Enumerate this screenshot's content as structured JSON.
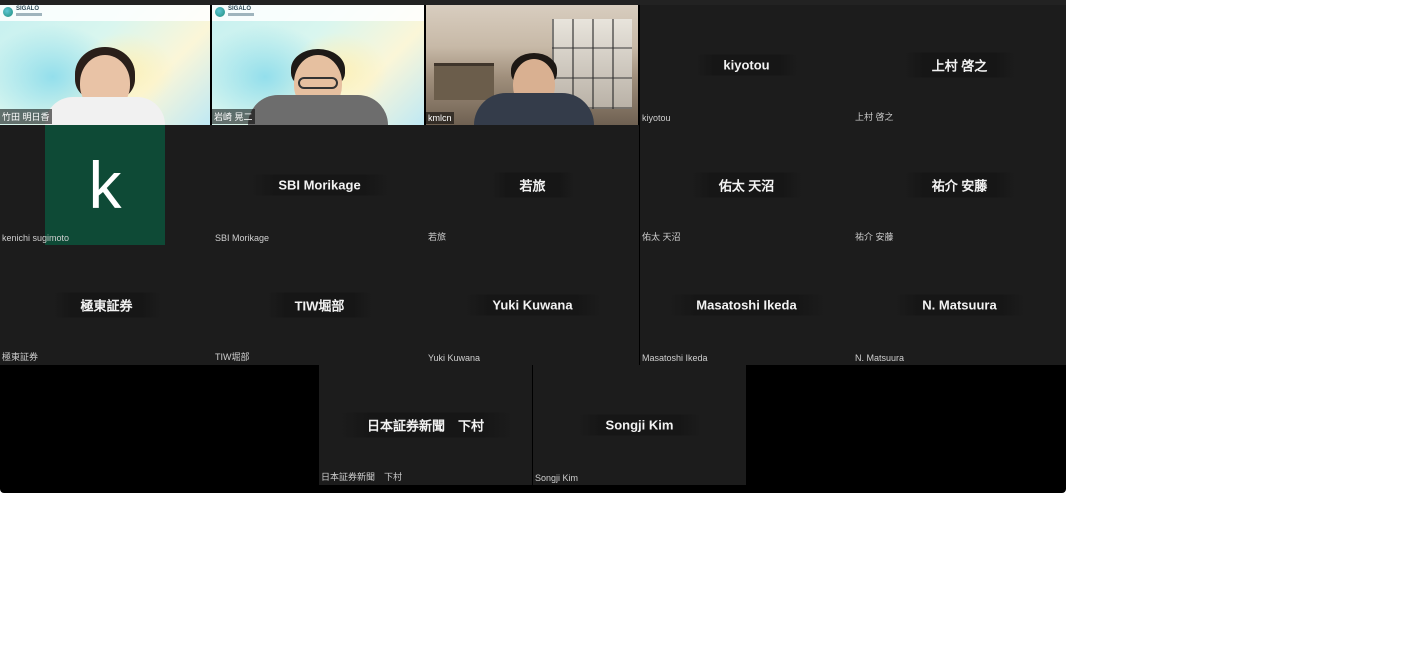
{
  "participants": [
    {
      "id": "p1",
      "corner_name": "竹田 明日香",
      "type": "video",
      "logo": "SIGALO"
    },
    {
      "id": "p2",
      "corner_name": "岩崎 晃二",
      "type": "video",
      "logo": "SIGALO"
    },
    {
      "id": "p3",
      "corner_name": "kmlcn",
      "type": "video"
    },
    {
      "id": "p4",
      "center_name": "kiyotou",
      "corner_name": "kiyotou",
      "type": "name"
    },
    {
      "id": "p5",
      "center_name": "上村 啓之",
      "corner_name": "上村 啓之",
      "type": "name"
    },
    {
      "id": "p6",
      "avatar_letter": "k",
      "corner_name": "kenichi sugimoto",
      "type": "avatar",
      "avatar_color": "#0e4a36"
    },
    {
      "id": "p7",
      "center_name": "SBI Morikage",
      "corner_name": "SBI Morikage",
      "type": "name"
    },
    {
      "id": "p8",
      "center_name": "若旅",
      "corner_name": "若旅",
      "type": "name"
    },
    {
      "id": "p9",
      "center_name": "佑太 天沼",
      "corner_name": "佑太 天沼",
      "type": "name"
    },
    {
      "id": "p10",
      "center_name": "祐介 安藤",
      "corner_name": "祐介 安藤",
      "type": "name"
    },
    {
      "id": "p11",
      "center_name": "極東証券",
      "corner_name": "極東証券",
      "type": "name"
    },
    {
      "id": "p12",
      "center_name": "TIW堀部",
      "corner_name": "TIW堀部",
      "type": "name"
    },
    {
      "id": "p13",
      "center_name": "Yuki Kuwana",
      "corner_name": "Yuki Kuwana",
      "type": "name"
    },
    {
      "id": "p14",
      "center_name": "Masatoshi Ikeda",
      "corner_name": "Masatoshi Ikeda",
      "type": "name"
    },
    {
      "id": "p15",
      "center_name": "N. Matsuura",
      "corner_name": "N. Matsuura",
      "type": "name"
    },
    {
      "id": "p16",
      "center_name": "日本証券新聞　下村",
      "corner_name": "日本証券新聞　下村",
      "type": "name"
    },
    {
      "id": "p17",
      "center_name": "Songji Kim",
      "corner_name": "Songji Kim",
      "type": "name"
    }
  ],
  "colors": {
    "tile_background": "#1c1c1c",
    "stage_background": "#000000",
    "avatar_green": "#0e4a36"
  }
}
